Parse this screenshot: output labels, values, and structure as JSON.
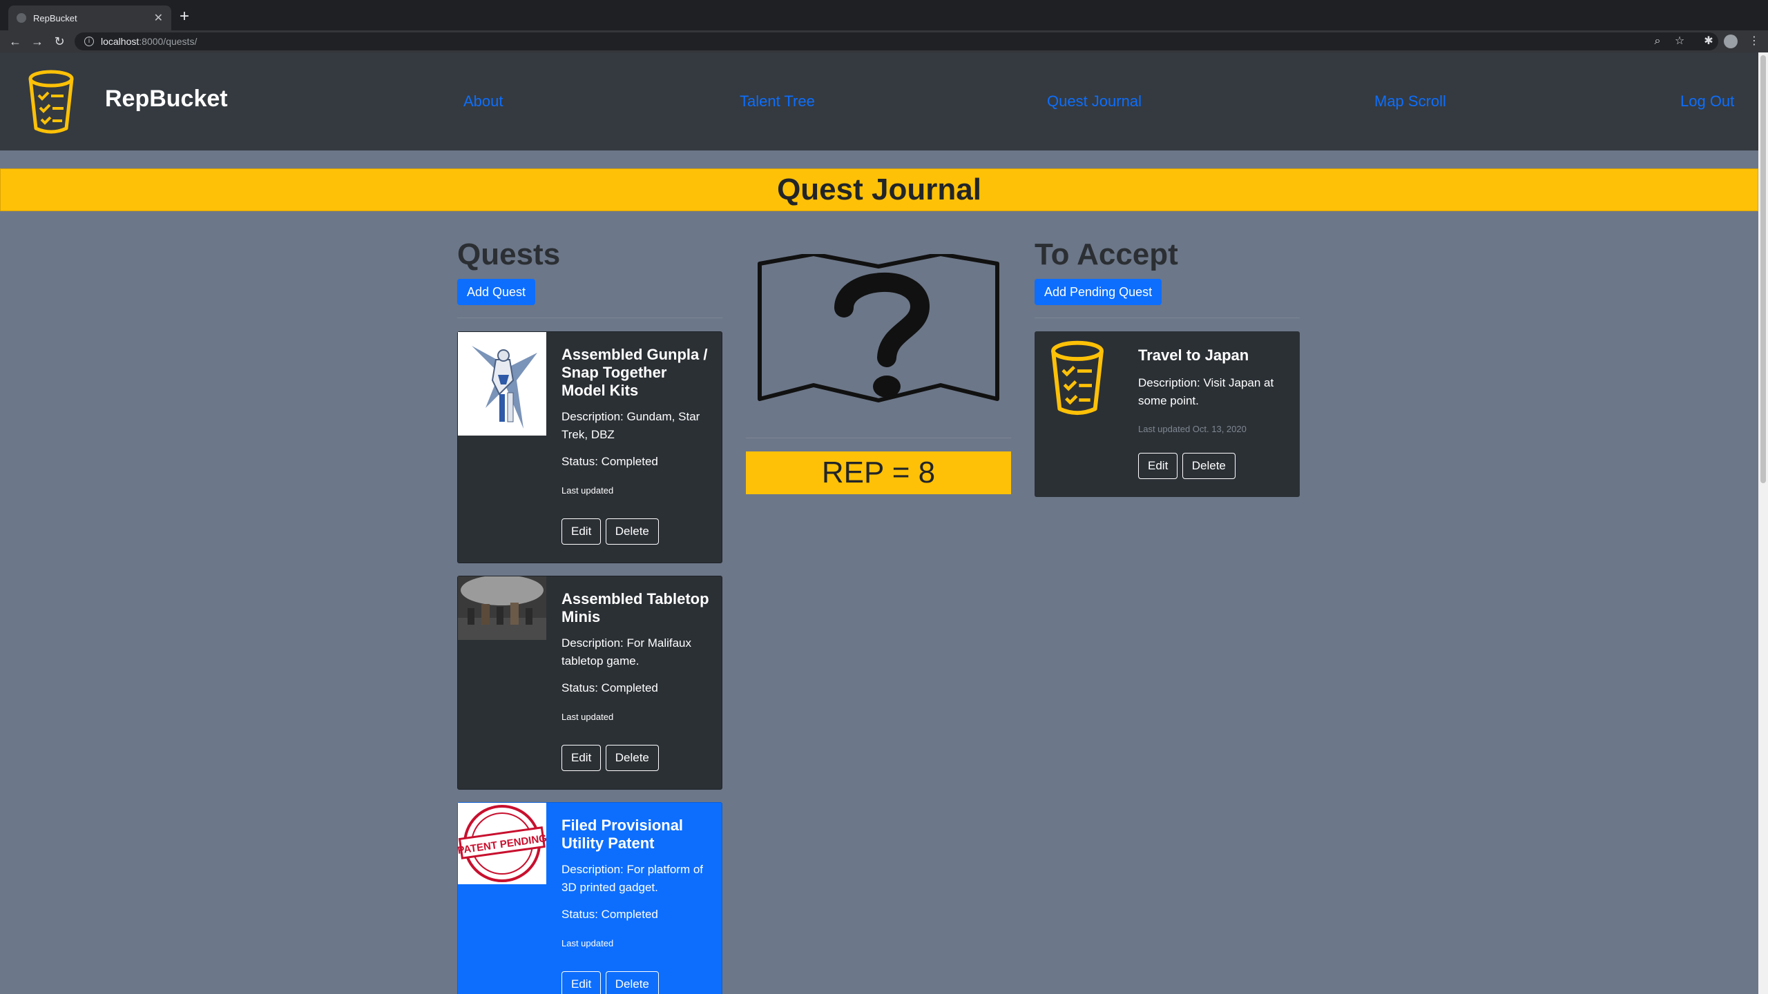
{
  "browser": {
    "tab_title": "RepBucket",
    "url_host": "localhost",
    "url_rest": ":8000/quests/"
  },
  "navbar": {
    "brand": "RepBucket",
    "links": [
      "About",
      "Talent Tree",
      "Quest Journal",
      "Map Scroll",
      "Log Out"
    ]
  },
  "page": {
    "title": "Quest Journal"
  },
  "quests": {
    "heading": "Quests",
    "add_label": "Add Quest",
    "items": [
      {
        "title": "Assembled Gunpla / Snap Together Model Kits",
        "description": "Description: Gundam, Star Trek, DBZ",
        "status": "Status: Completed",
        "updated": "Last updated",
        "edit": "Edit",
        "delete": "Delete"
      },
      {
        "title": "Assembled Tabletop Minis",
        "description": "Description: For Malifaux tabletop game.",
        "status": "Status: Completed",
        "updated": "Last updated",
        "edit": "Edit",
        "delete": "Delete"
      },
      {
        "title": "Filed Provisional Utility Patent",
        "description": "Description: For platform of 3D printed gadget.",
        "status": "Status: Completed",
        "updated": "Last updated",
        "edit": "Edit",
        "delete": "Delete",
        "stamp_text": "PATENT PENDING"
      }
    ]
  },
  "rep": {
    "label": "REP = 8"
  },
  "pending": {
    "heading": "To Accept",
    "add_label": "Add Pending Quest",
    "items": [
      {
        "title": "Travel to Japan",
        "description": "Description: Visit Japan at some point.",
        "updated": "Last updated Oct. 13, 2020",
        "edit": "Edit",
        "delete": "Delete"
      }
    ]
  },
  "colors": {
    "accent": "#ffc107",
    "primary": "#0d6efd",
    "navbar": "#343a40",
    "page_bg": "#6c7789"
  }
}
